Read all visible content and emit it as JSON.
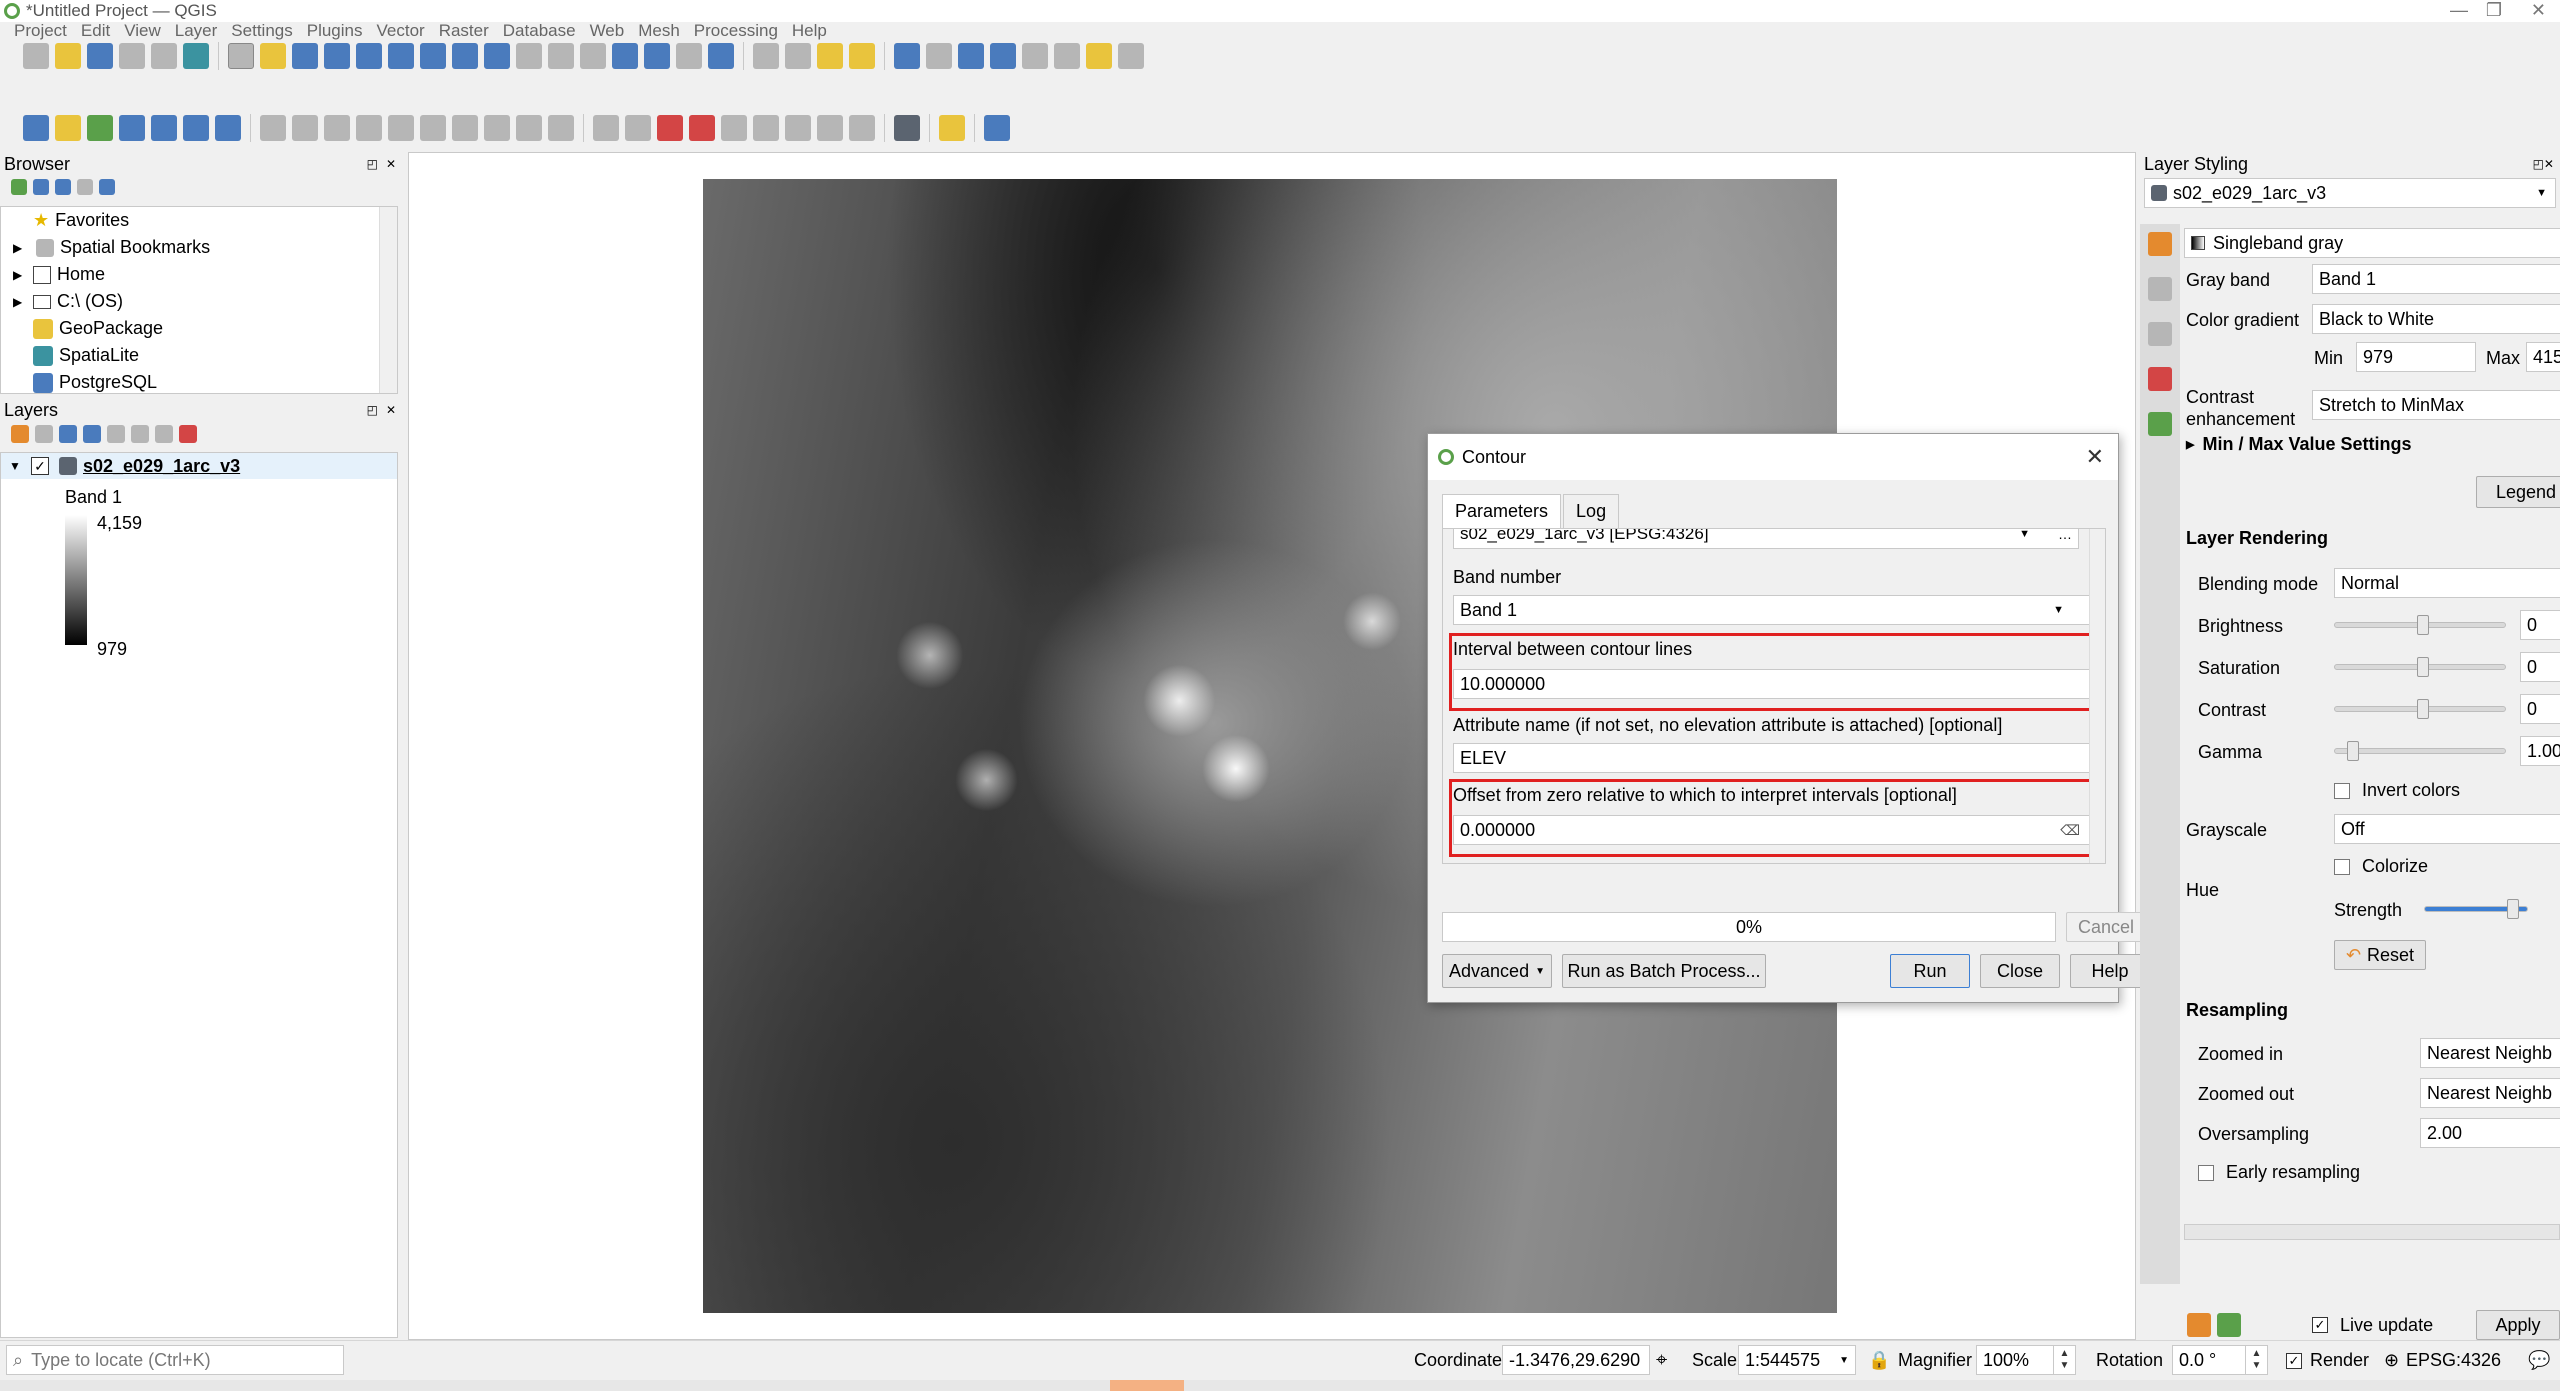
{
  "window": {
    "title": "*Untitled Project — QGIS",
    "minimize": "—",
    "maximize": "❐",
    "close": "✕"
  },
  "menu": [
    "Project",
    "Edit",
    "View",
    "Layer",
    "Settings",
    "Plugins",
    "Vector",
    "Raster",
    "Database",
    "Web",
    "Mesh",
    "Processing",
    "Help"
  ],
  "browser": {
    "title": "Browser",
    "items": [
      "Favorites",
      "Spatial Bookmarks",
      "Home",
      "C:\\ (OS)",
      "GeoPackage",
      "SpatiaLite",
      "PostgreSQL"
    ]
  },
  "layers": {
    "title": "Layers",
    "layer_name": "s02_e029_1arc_v3",
    "band": "Band 1",
    "max": "4,159",
    "min": "979"
  },
  "styling": {
    "title": "Layer Styling",
    "layer": "s02_e029_1arc_v3",
    "renderer": "Singleband gray",
    "gray_band_label": "Gray band",
    "gray_band": "Band 1",
    "color_gradient_label": "Color gradient",
    "color_gradient": "Black to White",
    "min_label": "Min",
    "min": "979",
    "max_label": "Max",
    "max": "415",
    "contrast_label": "Contrast enhancement",
    "contrast": "Stretch to MinMax",
    "minmax_settings": "Min / Max Value Settings",
    "legend": "Legend",
    "rendering_title": "Layer Rendering",
    "blending_label": "Blending mode",
    "blending": "Normal",
    "brightness_label": "Brightness",
    "brightness": "0",
    "saturation_label": "Saturation",
    "saturation": "0",
    "contrast2_label": "Contrast",
    "contrast2": "0",
    "gamma_label": "Gamma",
    "gamma": "1.00",
    "invert_label": "Invert colors",
    "grayscale_label": "Grayscale",
    "grayscale": "Off",
    "colorize_label": "Colorize",
    "hue_label": "Hue",
    "strength_label": "Strength",
    "reset": "Reset",
    "resampling_title": "Resampling",
    "zoomed_in_label": "Zoomed in",
    "zoomed_in": "Nearest Neighb",
    "zoomed_out_label": "Zoomed out",
    "zoomed_out": "Nearest Neighb",
    "oversampling_label": "Oversampling",
    "oversampling": "2.00",
    "early_label": "Early resampling",
    "live_update": "Live update",
    "apply": "Apply"
  },
  "dialog": {
    "title": "Contour",
    "tab_params": "Parameters",
    "tab_log": "Log",
    "input_layer": "s02_e029_1arc_v3 [EPSG:4326]",
    "band_label": "Band number",
    "band": "Band 1",
    "interval_label": "Interval between contour lines",
    "interval": "10.000000",
    "attr_label": "Attribute name (if not set, no elevation attribute is attached) [optional]",
    "attr": "ELEV",
    "offset_label": "Offset from zero relative to which to interpret intervals [optional]",
    "offset": "0.000000",
    "progress": "0%",
    "cancel": "Cancel",
    "advanced": "Advanced",
    "batch": "Run as Batch Process...",
    "run": "Run",
    "close": "Close",
    "help": "Help"
  },
  "statusbar": {
    "locate_placeholder": "Type to locate (Ctrl+K)",
    "coordinate_label": "Coordinate",
    "coordinate": "-1.3476,29.6290",
    "scale_label": "Scale",
    "scale": "1:544575",
    "magnifier_label": "Magnifier",
    "magnifier": "100%",
    "rotation_label": "Rotation",
    "rotation": "0.0 °",
    "render_label": "Render",
    "crs": "EPSG:4326"
  }
}
